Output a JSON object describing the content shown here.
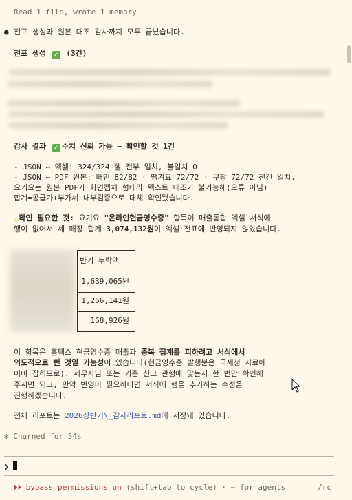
{
  "header_line": "Read 1 file, wrote 1 memory",
  "bullet": "●",
  "done_message": "전표 생성과 원본 대조 감사까지 모두 끝났습니다.",
  "voucher_section": {
    "title": "전표 생성",
    "count": "(3건)"
  },
  "audit_section": {
    "title": "감사 결과",
    "verdict": "수치 신뢰 가능 — 확인할 것 1건"
  },
  "audit_lines": [
    "- JSON ↔ 엑셀: 324/324 셀 전부 일치, 불일치 0",
    "- JSON ↔ PDF 원본: 배민 82/82 · 땡겨요 72/72 · 쿠팡 72/72 전건 일치.",
    "요기요는 원본 PDF가 화면캡처 형태라 텍스트 대조가 불가능해(오류 아님)",
    "합계=공급가+부가세 내부검증으로 대체 확인됐습니다."
  ],
  "warning": {
    "label": "확인 필요한 것:",
    "text_a": " 요기요 ",
    "item": "\"온라인현금영수증\"",
    "text_b": " 항목이 매출통합 엑셀 서식에",
    "line2_a": "행이 없어서 세 매장 합계 ",
    "amount": "3,074,132원",
    "line2_b": "이 엑셀·전표에 반영되지 않았습니다."
  },
  "table": {
    "header": "반기 누락액",
    "rows": [
      "1,639,065원",
      "1,266,141원",
      "168,926원"
    ]
  },
  "explanation": {
    "l1_a": "이 항목은 홈택스 현금영수증 매출과 ",
    "l1_b": "중복 집계를 피하려고 서식에서",
    "l2_a": "의도적으로 뺀 것일 가능성",
    "l2_b": "이 있습니다(현금영수증 발행분은 국세청 자료에",
    "l3": "이미 잡히므로). 세무사님 또는 기존 신고 관행에 맞는지 한 번만 확인해",
    "l4": "주시면 되고, 만약 반영이 필요하다면 서식에 행을 추가하는 수정을",
    "l5": "진행하겠습니다."
  },
  "report": {
    "text_a": "전체 리포트는 ",
    "filename": "2026상반기\\_감사리포트.md",
    "text_b": "에 저장돼 있습니다."
  },
  "churned": "✻ Churned for 54s",
  "prompt_symbol": "❯",
  "status_bar": {
    "arrows": "⏵⏵",
    "mode": "bypass permissions on",
    "hint": "(shift+tab to cycle) · ← for agents",
    "right": "/rc"
  },
  "colors": {
    "background": "#fdf8ea",
    "check_green": "#5fb04b",
    "status_red": "#b03a3a",
    "link_blue": "#3a58a8"
  }
}
